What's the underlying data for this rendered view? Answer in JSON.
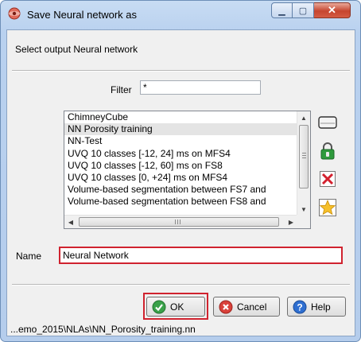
{
  "window": {
    "title": "Save Neural network as"
  },
  "prompt": "Select output Neural network",
  "filter": {
    "label": "Filter",
    "value": "*"
  },
  "list": {
    "items": [
      "ChimneyCube",
      "NN Porosity training",
      "NN-Test",
      "UVQ 10 classes [-12, 24] ms on MFS4",
      "UVQ 10 classes [-12, 60] ms on FS8",
      "UVQ 10 classes [0, +24] ms on MFS4",
      "Volume-based segmentation between FS7 and",
      "Volume-based segmentation between FS8 and"
    ],
    "selected": "NN Porosity training"
  },
  "name": {
    "label": "Name",
    "value": "Neural Network"
  },
  "buttons": {
    "ok": "OK",
    "cancel": "Cancel",
    "help": "Help"
  },
  "status": "...emo_2015\\NLAs\\NN_Porosity_training.nn",
  "colors": {
    "highlight_red": "#d0232f",
    "title_bar": "#b9d1ef"
  }
}
